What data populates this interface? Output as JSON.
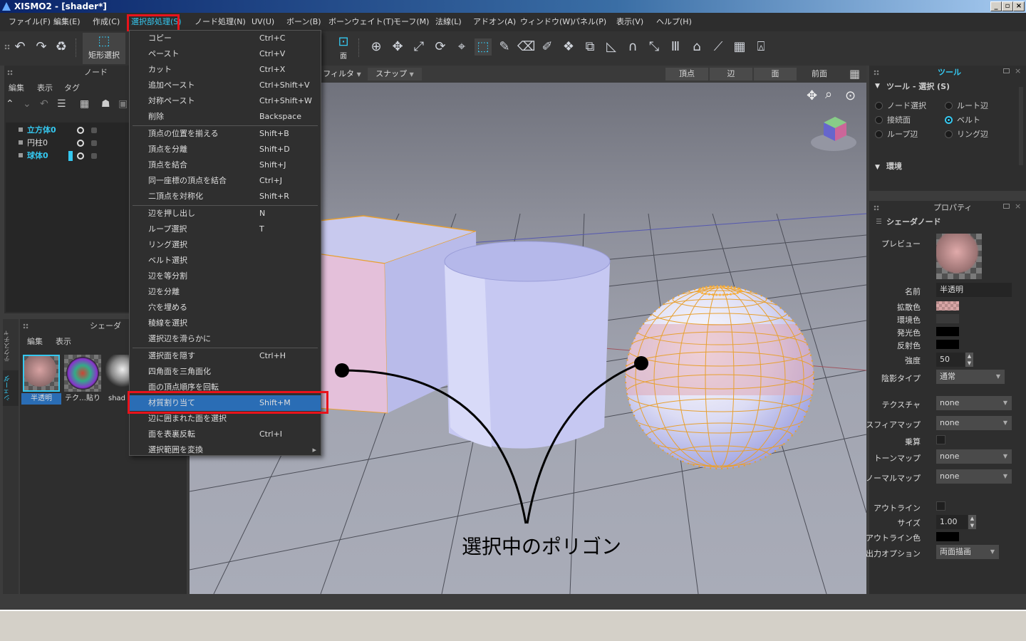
{
  "window": {
    "title": "XISMO2 - [shader*]",
    "min": "_",
    "max": "▫",
    "close": "×"
  },
  "menubar": [
    {
      "label": "ファイル(F)"
    },
    {
      "label": "編集(E)"
    },
    {
      "label": "作成(C)"
    },
    {
      "label": "選択部処理(S)",
      "active": true
    },
    {
      "label": "ノード処理(N)"
    },
    {
      "label": "UV(U)"
    },
    {
      "label": "ボーン(B)"
    },
    {
      "label": "ボーンウェイト(T)"
    },
    {
      "label": "モーフ(M)"
    },
    {
      "label": "法線(L)"
    },
    {
      "label": "アドオン(A)"
    },
    {
      "label": "ウィンドウ(W)"
    },
    {
      "label": "パネル(P)"
    },
    {
      "label": "表示(V)"
    },
    {
      "label": "ヘルプ(H)"
    }
  ],
  "toolbar": {
    "rect_select_label": "矩形選択",
    "face_label": "面",
    "accent": "#35c8f0"
  },
  "node_panel": {
    "title": "ノード",
    "menu": [
      "編集",
      "表示",
      "タグ"
    ],
    "items": [
      {
        "label": "立方体0",
        "color": "#35c8f0"
      },
      {
        "label": "円柱0",
        "color": "#dddddd"
      },
      {
        "label": "球体0",
        "color": "#35c8f0"
      }
    ]
  },
  "shader_panel": {
    "title": "シェーダ",
    "menu": [
      "編集",
      "表示"
    ],
    "thumbs": [
      "半透明",
      "テク…貼り",
      "shad"
    ]
  },
  "side_tabs": [
    "テクスチャ",
    "シェーダ"
  ],
  "context_menu": {
    "items": [
      {
        "label": "コピー",
        "shortcut": "Ctrl+C"
      },
      {
        "label": "ペースト",
        "shortcut": "Ctrl+V"
      },
      {
        "label": "カット",
        "shortcut": "Ctrl+X"
      },
      {
        "label": "追加ペースト",
        "shortcut": "Ctrl+Shift+V"
      },
      {
        "label": "対称ペースト",
        "shortcut": "Ctrl+Shift+W"
      },
      {
        "label": "削除",
        "shortcut": "Backspace"
      },
      {
        "label": "頂点の位置を揃える",
        "shortcut": "Shift+B"
      },
      {
        "label": "頂点を分離",
        "shortcut": "Shift+D"
      },
      {
        "label": "頂点を結合",
        "shortcut": "Shift+J"
      },
      {
        "label": "同一座標の頂点を結合",
        "shortcut": "Ctrl+J"
      },
      {
        "label": "二頂点を対称化",
        "shortcut": "Shift+R"
      },
      {
        "label": "辺を押し出し",
        "shortcut": "N"
      },
      {
        "label": "ループ選択",
        "shortcut": "T"
      },
      {
        "label": "リング選択",
        "shortcut": ""
      },
      {
        "label": "ベルト選択",
        "shortcut": ""
      },
      {
        "label": "辺を等分割",
        "shortcut": ""
      },
      {
        "label": "辺を分離",
        "shortcut": ""
      },
      {
        "label": "穴を埋める",
        "shortcut": ""
      },
      {
        "label": "稜線を選択",
        "shortcut": ""
      },
      {
        "label": "選択辺を滑らかに",
        "shortcut": ""
      },
      {
        "label": "選択面を隠す",
        "shortcut": "Ctrl+H"
      },
      {
        "label": "四角面を三角面化",
        "shortcut": ""
      },
      {
        "label": "面の頂点順序を回転",
        "shortcut": ""
      },
      {
        "label": "材質割り当て",
        "shortcut": "Shift+M",
        "highlight": true
      },
      {
        "label": "辺に囲まれた面を選択",
        "shortcut": ""
      },
      {
        "label": "面を表裏反転",
        "shortcut": "Ctrl+I"
      },
      {
        "label": "選択範囲を変換",
        "shortcut": "",
        "submenu": true
      }
    ]
  },
  "viewport": {
    "filter_label": "フィルタ",
    "snap_label": "スナップ",
    "mode_buttons": [
      "頂点",
      "辺",
      "面"
    ],
    "view_label": "前面",
    "annotation": "選択中のポリゴン"
  },
  "tool_panel": {
    "tab": "ツール",
    "section": "ツール - 選択 (S)",
    "options": [
      {
        "label": "ノード選択",
        "selected": false
      },
      {
        "label": "ルート辺",
        "selected": false
      },
      {
        "label": "接続面",
        "selected": false
      },
      {
        "label": "ベルト",
        "selected": true
      },
      {
        "label": "ループ辺",
        "selected": false
      },
      {
        "label": "リング辺",
        "selected": false
      }
    ],
    "env_section": "環境"
  },
  "prop_panel": {
    "title": "プロパティ",
    "section": "シェーダノード",
    "preview_label": "プレビュー",
    "name_label": "名前",
    "name_value": "半透明",
    "diffuse_label": "拡散色",
    "ambient_label": "環境色",
    "emissive_label": "発光色",
    "specular_label": "反射色",
    "power_label": "強度",
    "power_value": "50",
    "shade_label": "陰影タイプ",
    "shade_value": "通常",
    "texture_label": "テクスチャ",
    "texture_value": "none",
    "sphere_label": "スフィアマップ",
    "sphere_value": "none",
    "mult_label": "乗算",
    "toon_label": "トーンマップ",
    "toon_value": "none",
    "normal_label": "ノーマルマップ",
    "normal_value": "none",
    "outline_label": "アウトライン",
    "size_label": "サイズ",
    "size_value": "1.00",
    "outline_color_label": "アウトライン色",
    "output_label": "出力オプション",
    "output_value": "両面描画"
  }
}
